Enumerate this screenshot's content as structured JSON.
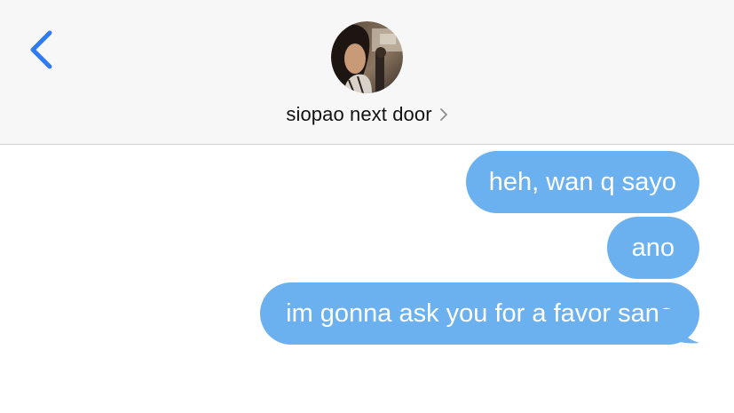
{
  "header": {
    "back_icon": "chevron-left-icon",
    "avatar_icon": "contact-photo-avatar",
    "contact_name": "siopao next door",
    "contact_chevron_icon": "chevron-right-icon"
  },
  "messages": [
    {
      "text": "heh, wan q sayo",
      "sender": "me"
    },
    {
      "text": "ano",
      "sender": "me"
    },
    {
      "text": "im gonna ask you for a favor sana",
      "sender": "me"
    }
  ],
  "colors": {
    "header_bg": "#f7f7f7",
    "accent": "#2f7bf5",
    "bubble": "#6bb1f0",
    "bubble_text": "#ffffff",
    "divider": "#cfcfd2"
  }
}
